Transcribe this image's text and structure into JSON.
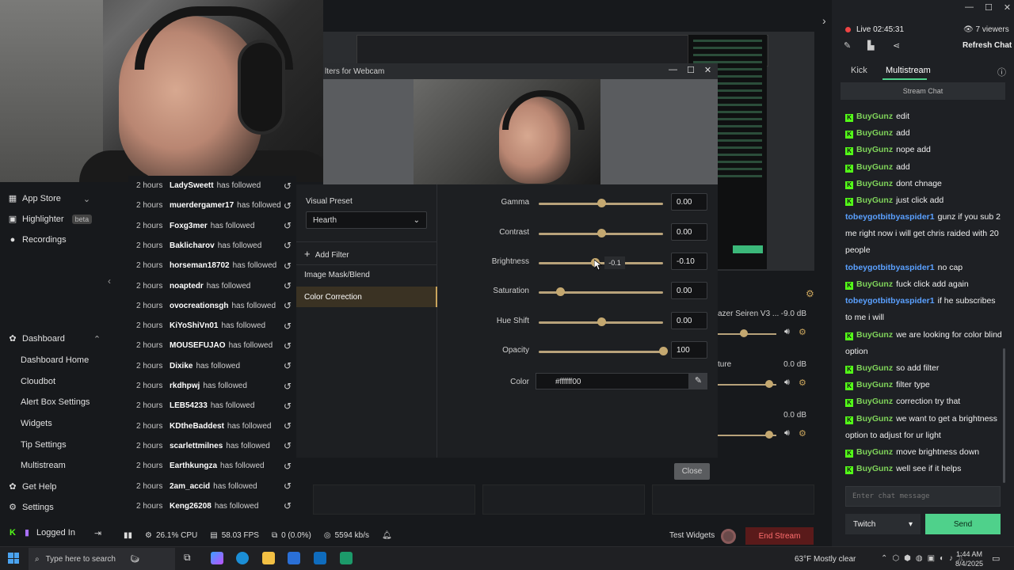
{
  "window": {
    "dialog_title": "lters for Webcam"
  },
  "nav": {
    "app_store": "App Store",
    "highlighter": "Highlighter",
    "highlighter_badge": "beta",
    "recordings": "Recordings",
    "dashboard": "Dashboard",
    "sub": [
      "Dashboard Home",
      "Cloudbot",
      "Alert Box Settings",
      "Widgets",
      "Tip Settings",
      "Multistream"
    ],
    "get_help": "Get Help",
    "settings": "Settings",
    "logged_in": "Logged In"
  },
  "feed": [
    {
      "time": "2 hours",
      "name": "LadySweett",
      "action": "has followed"
    },
    {
      "time": "2 hours",
      "name": "muerdergamer17",
      "action": "has followed"
    },
    {
      "time": "2 hours",
      "name": "Foxg3mer",
      "action": "has followed"
    },
    {
      "time": "2 hours",
      "name": "Baklicharov",
      "action": "has followed"
    },
    {
      "time": "2 hours",
      "name": "horseman18702",
      "action": "has followed"
    },
    {
      "time": "2 hours",
      "name": "noaptedr",
      "action": "has followed"
    },
    {
      "time": "2 hours",
      "name": "ovocreationsgh",
      "action": "has followed"
    },
    {
      "time": "2 hours",
      "name": "KiYoShiVn01",
      "action": "has followed"
    },
    {
      "time": "2 hours",
      "name": "MOUSEFUJAO",
      "action": "has followed"
    },
    {
      "time": "2 hours",
      "name": "Dixike",
      "action": "has followed"
    },
    {
      "time": "2 hours",
      "name": "rkdhpwj",
      "action": "has followed"
    },
    {
      "time": "2 hours",
      "name": "LEB54233",
      "action": "has followed"
    },
    {
      "time": "2 hours",
      "name": "KDtheBaddest",
      "action": "has followed"
    },
    {
      "time": "2 hours",
      "name": "scarlettmilnes",
      "action": "has followed"
    },
    {
      "time": "2 hours",
      "name": "Earthkungza",
      "action": "has followed"
    },
    {
      "time": "2 hours",
      "name": "2am_accid",
      "action": "has followed"
    },
    {
      "time": "2 hours",
      "name": "Keng26208",
      "action": "has followed"
    }
  ],
  "filters": {
    "visual_preset_label": "Visual Preset",
    "visual_preset_value": "Hearth",
    "add_filter": "Add Filter",
    "list": [
      "Image Mask/Blend",
      "Color Correction"
    ],
    "params": [
      {
        "label": "Gamma",
        "value": "0.00",
        "fraction": 0.5
      },
      {
        "label": "Contrast",
        "value": "0.00",
        "fraction": 0.5
      },
      {
        "label": "Brightness",
        "value": "-0.10",
        "fraction": 0.45
      },
      {
        "label": "Saturation",
        "value": "0.00",
        "fraction": 0.17
      },
      {
        "label": "Hue Shift",
        "value": "0.00",
        "fraction": 0.5
      },
      {
        "label": "Opacity",
        "value": "100",
        "fraction": 1.0
      }
    ],
    "tooltip": "-0.1",
    "color_label": "Color",
    "color_value": "#ffffff00",
    "close": "Close"
  },
  "mixer": [
    {
      "name": "azer Seiren V3 ...",
      "db": "-9.0 dB",
      "fraction": 0.45
    },
    {
      "name": "ture",
      "db": "0.0 dB",
      "fraction": 0.88
    },
    {
      "name": "",
      "db": "0.0 dB",
      "fraction": 0.88
    }
  ],
  "status": {
    "cpu": "26.1% CPU",
    "fps": "58.03 FPS",
    "dropped": "0 (0.0%)",
    "bitrate": "5594 kb/s",
    "test_widgets": "Test Widgets",
    "end_stream": "End Stream"
  },
  "chat": {
    "live": "Live 02:45:31",
    "viewers": "7 viewers",
    "refresh": "Refresh Chat",
    "tabs": [
      "Kick",
      "Multistream"
    ],
    "stream_chat": "Stream Chat",
    "messages": [
      {
        "user": "BuyGunz",
        "text": "edit",
        "twitch": false
      },
      {
        "user": "BuyGunz",
        "text": "add",
        "twitch": false
      },
      {
        "user": "BuyGunz",
        "text": "nope add",
        "twitch": false
      },
      {
        "user": "BuyGunz",
        "text": "add",
        "twitch": false
      },
      {
        "user": "BuyGunz",
        "text": "dont chnage",
        "twitch": false
      },
      {
        "user": "BuyGunz",
        "text": "just click add",
        "twitch": false
      },
      {
        "user": "tobeygotbitbyaspider1",
        "text": "gunz if you sub 2 me right now i will get chris raided with 20 people",
        "twitch": true
      },
      {
        "user": "tobeygotbitbyaspider1",
        "text": "no cap",
        "twitch": true
      },
      {
        "user": "BuyGunz",
        "text": "fuck click add again",
        "twitch": false
      },
      {
        "user": "tobeygotbitbyaspider1",
        "text": "if he subscribes to me i will",
        "twitch": true
      },
      {
        "user": "BuyGunz",
        "text": "we are looking for color blind option",
        "twitch": false
      },
      {
        "user": "BuyGunz",
        "text": "so add filter",
        "twitch": false
      },
      {
        "user": "BuyGunz",
        "text": "filter type",
        "twitch": false
      },
      {
        "user": "BuyGunz",
        "text": "correction try that",
        "twitch": false
      },
      {
        "user": "BuyGunz",
        "text": "we want to get a brightness option to adjust for ur light",
        "twitch": false
      },
      {
        "user": "BuyGunz",
        "text": "move brightness down",
        "twitch": false
      },
      {
        "user": "BuyGunz",
        "text": "well see if it helps",
        "twitch": false
      }
    ],
    "input_placeholder": "Enter chat message",
    "platform": "Twitch",
    "send": "Send"
  },
  "taskbar": {
    "search_placeholder": "Type here to search",
    "weather": "63°F  Mostly clear",
    "time": "1:44 AM",
    "date": "8/4/2025"
  }
}
